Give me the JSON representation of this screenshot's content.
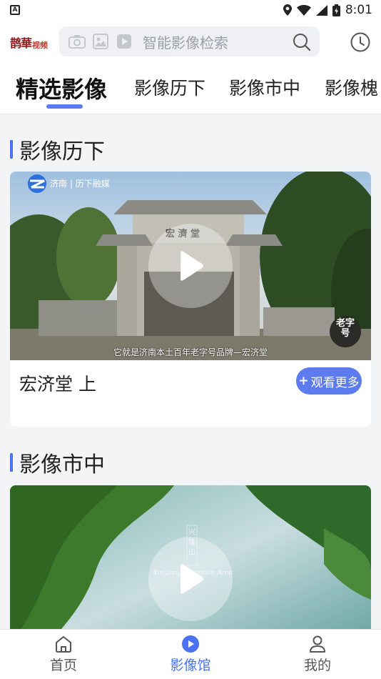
{
  "status_bar": {
    "time": "8:01",
    "notification_glyph": "A"
  },
  "header": {
    "logo_text": "鹊華",
    "logo_sub": "视频",
    "search_placeholder": "智能影像检索"
  },
  "tabs": [
    {
      "label": "精选影像",
      "active": true
    },
    {
      "label": "影像历下",
      "active": false
    },
    {
      "label": "影像市中",
      "active": false
    },
    {
      "label": "影像槐",
      "active": false
    }
  ],
  "sections": [
    {
      "title": "影像历下",
      "video": {
        "watermark": "济南 | 历下融媒",
        "caption": "它就是济南本土百年老字号品牌—宏济堂",
        "gate_plaque": "宏 濟 堂",
        "corner_logo": "老字号"
      },
      "card_title": "宏济堂 上",
      "more_label": "观看更多"
    },
    {
      "title": "影像市中",
      "video": {
        "sign_text": "兴隆山",
        "sign_subtext": "Xinglong Mountain Area"
      }
    }
  ],
  "bottom_nav": [
    {
      "label": "首页",
      "icon": "home-icon",
      "active": false
    },
    {
      "label": "影像馆",
      "icon": "play-circle-icon",
      "active": true
    },
    {
      "label": "我的",
      "icon": "user-icon",
      "active": false
    }
  ],
  "colors": {
    "accent": "#4a72f2",
    "button": "#5b7bef"
  }
}
